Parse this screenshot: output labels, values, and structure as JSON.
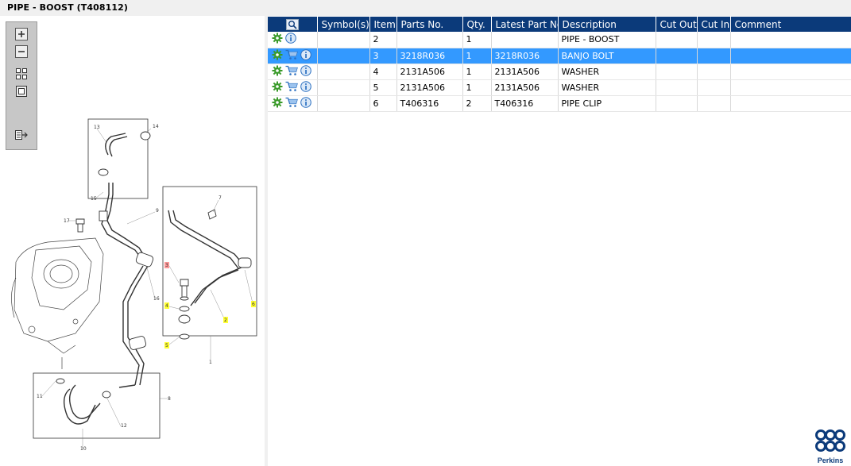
{
  "window": {
    "title": "PIPE - BOOST (T408112)"
  },
  "zoom_toolbar": {
    "buttons": [
      {
        "name": "zoom-in-icon"
      },
      {
        "name": "zoom-out-icon"
      },
      {
        "name": "fit-all-icon"
      },
      {
        "name": "actual-size-icon"
      },
      {
        "name": "export-icon"
      }
    ]
  },
  "diagram": {
    "callouts": [
      "13",
      "14",
      "15",
      "9",
      "17",
      "7",
      "3",
      "4",
      "2",
      "6",
      "5",
      "16",
      "1",
      "8",
      "11",
      "12",
      "10"
    ],
    "highlighted": [
      "3",
      "4",
      "2",
      "6",
      "5"
    ]
  },
  "table": {
    "columns": [
      "",
      "Symbol(s)",
      "Item",
      "Parts No.",
      "Qty.",
      "Latest Part No.",
      "Description",
      "Cut Out",
      "Cut In",
      "Comment"
    ],
    "rows": [
      {
        "cart": false,
        "item": "2",
        "part_no": "",
        "qty": "1",
        "latest": "",
        "description": "PIPE - BOOST",
        "cut_out": "",
        "cut_in": "",
        "comment": "",
        "selected": false
      },
      {
        "cart": true,
        "item": "3",
        "part_no": "3218R036",
        "qty": "1",
        "latest": "3218R036",
        "description": "BANJO BOLT",
        "cut_out": "",
        "cut_in": "",
        "comment": "",
        "selected": true
      },
      {
        "cart": true,
        "item": "4",
        "part_no": "2131A506",
        "qty": "1",
        "latest": "2131A506",
        "description": "WASHER",
        "cut_out": "",
        "cut_in": "",
        "comment": "",
        "selected": false
      },
      {
        "cart": true,
        "item": "5",
        "part_no": "2131A506",
        "qty": "1",
        "latest": "2131A506",
        "description": "WASHER",
        "cut_out": "",
        "cut_in": "",
        "comment": "",
        "selected": false
      },
      {
        "cart": true,
        "item": "6",
        "part_no": "T406316",
        "qty": "2",
        "latest": "T406316",
        "description": "PIPE CLIP",
        "cut_out": "",
        "cut_in": "",
        "comment": "",
        "selected": false
      }
    ]
  },
  "brand": {
    "name": "Perkins",
    "color": "#0b3a7a"
  },
  "colors": {
    "header_bg": "#0b3a7a",
    "selected_row": "#3399ff",
    "highlight_callout": "#ffff33",
    "gear_green": "#3a9a2a",
    "info_blue": "#2a6fc0"
  }
}
